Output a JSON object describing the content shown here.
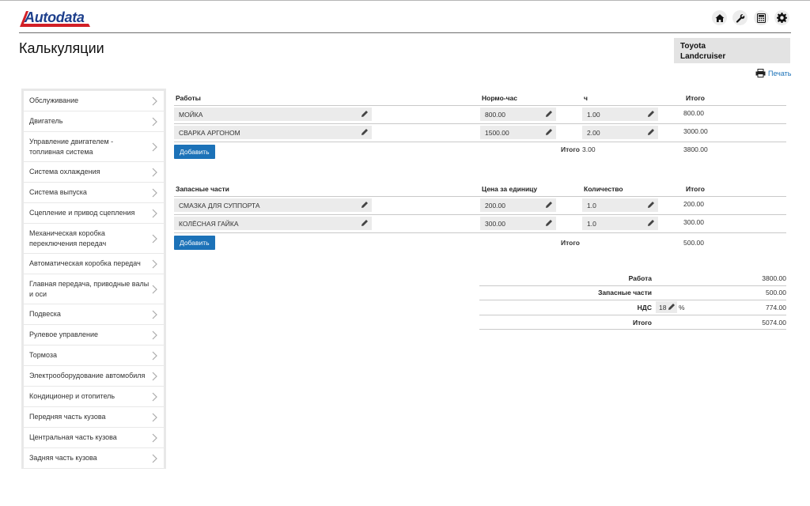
{
  "app": {
    "logo_text": "Autodata",
    "page_title": "Калькуляции",
    "vehicle": [
      "Toyota",
      "Landcruiser"
    ],
    "print_label": "Печать"
  },
  "header_icons": [
    "home-icon",
    "wrench-icon",
    "calculator-icon",
    "gear-icon"
  ],
  "sidebar": {
    "items": [
      {
        "label": "Обслуживание"
      },
      {
        "label": "Двигатель"
      },
      {
        "label": "Управление двигателем - топливная система"
      },
      {
        "label": "Система охлаждения"
      },
      {
        "label": "Система выпуска"
      },
      {
        "label": "Сцепление и привод сцепления"
      },
      {
        "label": "Механическая коробка переключения передач"
      },
      {
        "label": "Автоматическая коробка передач"
      },
      {
        "label": "Главная передача, приводные валы и оси"
      },
      {
        "label": "Подвеска"
      },
      {
        "label": "Рулевое управление"
      },
      {
        "label": "Тормоза"
      },
      {
        "label": "Электрооборудование автомобиля"
      },
      {
        "label": "Кондиционер и отопитель"
      },
      {
        "label": "Передняя часть кузова"
      },
      {
        "label": "Центральная часть кузова"
      },
      {
        "label": "Задняя часть кузова"
      }
    ]
  },
  "labor": {
    "headers": {
      "work": "Работы",
      "rate": "Нормо-час",
      "hours": "ч",
      "total": "Итого"
    },
    "rows": [
      {
        "name": "МОЙКА",
        "rate": "800.00",
        "hours": "1.00",
        "total": "800.00"
      },
      {
        "name": "СВАРКА АРГОНОМ",
        "rate": "1500.00",
        "hours": "2.00",
        "total": "3000.00"
      }
    ],
    "add_label": "Добавить",
    "total_label": "Итого",
    "total_hours": "3.00",
    "total_value": "3800.00"
  },
  "parts": {
    "headers": {
      "part": "Запасные части",
      "price": "Цена за единицу",
      "qty": "Количество",
      "total": "Итого"
    },
    "rows": [
      {
        "name": "СМАЗКА ДЛЯ СУППОРТА",
        "price": "200.00",
        "qty": "1.0",
        "total": "200.00"
      },
      {
        "name": "КОЛЁСНАЯ ГАЙКА",
        "price": "300.00",
        "qty": "1.0",
        "total": "300.00"
      }
    ],
    "add_label": "Добавить",
    "total_label": "Итого",
    "total_value": "500.00"
  },
  "summary": {
    "labor_label": "Работа",
    "labor_value": "3800.00",
    "parts_label": "Запасные части",
    "parts_value": "500.00",
    "vat_label": "НДС",
    "vat_rate": "18",
    "vat_percent": "%",
    "vat_value": "774.00",
    "total_label": "Итого",
    "total_value": "5074.00"
  },
  "colors": {
    "accent": "#1c72b8",
    "logo": "#1d3f8c",
    "logo_red": "#d21f26"
  }
}
